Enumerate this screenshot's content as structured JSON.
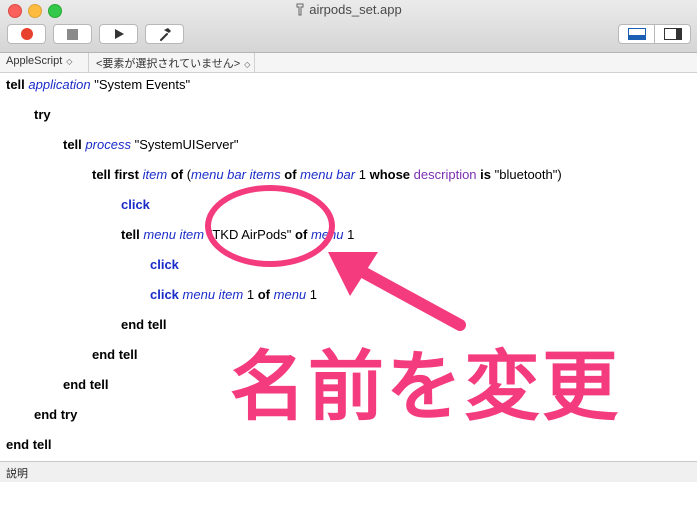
{
  "window": {
    "title": "airpods_set.app",
    "icon": "applescript-app-icon"
  },
  "toolbar": {
    "record": "record-button",
    "stop": "stop-button",
    "run": "run-button",
    "compile": "compile-button"
  },
  "navbar": {
    "language": "AppleScript",
    "element": "<要素が選択されていません>"
  },
  "code": {
    "l1": [
      "tell",
      "application",
      "\"System Events\""
    ],
    "l2": [
      "try"
    ],
    "l3": [
      "tell",
      "process",
      "\"SystemUIServer\""
    ],
    "l4": [
      "tell",
      "first",
      "item",
      "of",
      "(",
      "menu bar items",
      "of",
      "menu bar",
      "1",
      "whose",
      "description",
      "is",
      "\"bluetooth\")"
    ],
    "l5": [
      "click"
    ],
    "l6": [
      "tell",
      "menu item",
      "\"TKD AirPods\"",
      "of",
      "menu",
      "1"
    ],
    "l7": [
      "click"
    ],
    "l8": [
      "click",
      "menu item",
      "1",
      "of",
      "menu",
      "1"
    ],
    "l9": [
      "end tell"
    ],
    "l10": [
      "end tell"
    ],
    "l11": [
      "end tell"
    ],
    "l12": [
      "end try"
    ],
    "l13": [
      "end tell"
    ]
  },
  "annotation": {
    "label": "名前を変更",
    "color": "#f43b7d"
  },
  "description_pane": {
    "label": "説明"
  }
}
